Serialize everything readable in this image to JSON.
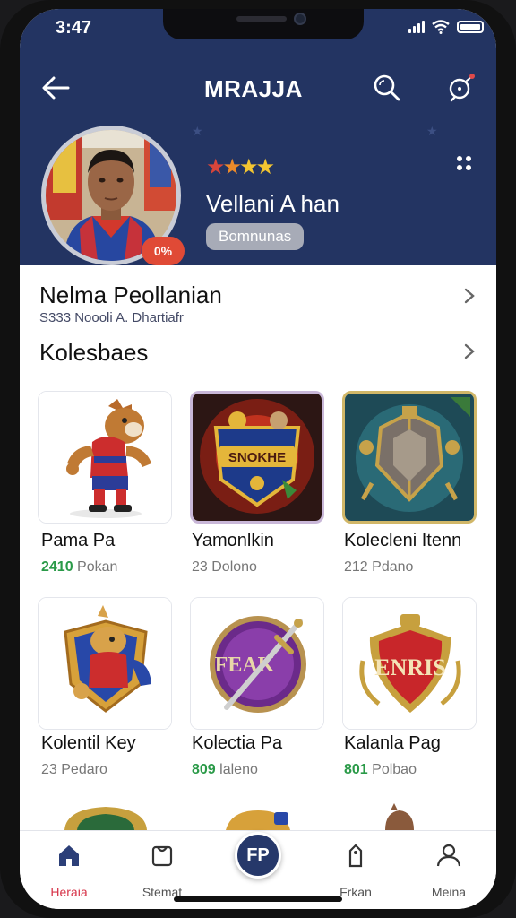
{
  "status_bar": {
    "time": "3:47"
  },
  "header": {
    "title": "MRAJJA",
    "back_icon": "arrow-left-icon",
    "search_icon": "search-icon",
    "notify_icon": "notification-icon"
  },
  "profile": {
    "name": "Vellani A han",
    "pill": "Bomnunas",
    "badge": "0%",
    "rating_icons": [
      "star-red",
      "star-orange",
      "star-yellow",
      "star-yellow"
    ]
  },
  "section_profile": {
    "title": "Nelma Peollanian",
    "subtitle": "S333 Noooli A. Dhartiafr"
  },
  "section_collection": {
    "title": "Kolesbaes"
  },
  "cards": [
    {
      "name": "Pama Pa",
      "meta_num": "2410",
      "meta_text": "Pokan",
      "highlight": true
    },
    {
      "name": "Yamonlkin",
      "meta_num": "23",
      "meta_text": "Dolono",
      "highlight": false
    },
    {
      "name": "Kolecleni Itenn",
      "meta_num": "212",
      "meta_text": "Pdano",
      "highlight": false
    },
    {
      "name": "Kolentil Key",
      "meta_num": "23",
      "meta_text": "Pedaro",
      "highlight": false
    },
    {
      "name": "Kolectia Pa",
      "meta_num": "809",
      "meta_text": "laleno",
      "highlight": true
    },
    {
      "name": "Kalanla Pag",
      "meta_num": "801",
      "meta_text": "Polbao",
      "highlight": true
    }
  ],
  "card_art": {
    "c3_label": "SNOKHE",
    "c5_label": "FEAK",
    "c6_label": "ENRIS"
  },
  "nav": {
    "items": [
      {
        "label": "Heraia",
        "icon": "home-icon",
        "active": true
      },
      {
        "label": "Stemat",
        "icon": "bag-icon",
        "active": false
      },
      {
        "label": "Frkan",
        "icon": "tag-icon",
        "active": false
      },
      {
        "label": "Meina",
        "icon": "user-icon",
        "active": false
      }
    ],
    "fab_label": "FP"
  },
  "colors": {
    "header_bg": "#233462",
    "accent_red": "#d7354a",
    "green": "#2a9a48"
  }
}
